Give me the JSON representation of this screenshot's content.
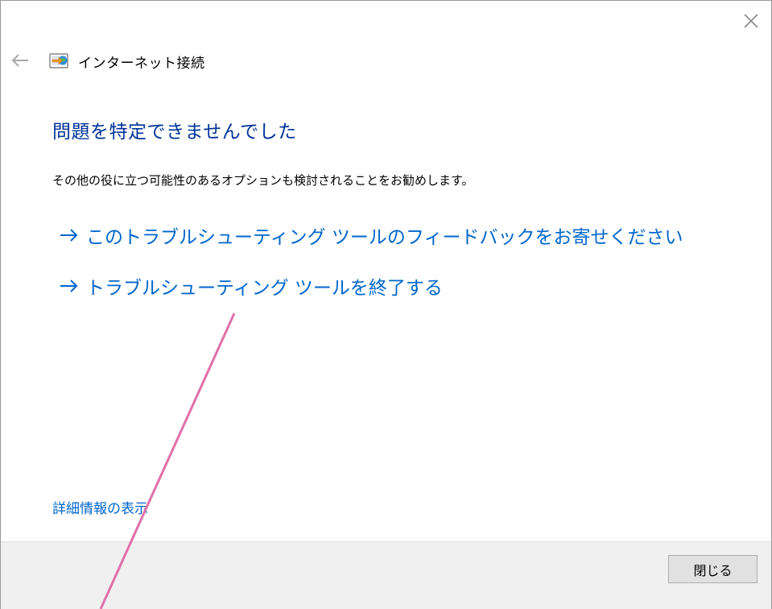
{
  "window": {
    "title": "インターネット接続",
    "close_icon": "close-icon",
    "back_icon": "back-arrow-icon",
    "app_icon": "network-connection-icon"
  },
  "main": {
    "heading": "問題を特定できませんでした",
    "description": "その他の役に立つ可能性のあるオプションも検討されることをお勧めします。",
    "options": [
      {
        "label": "このトラブルシューティング ツールのフィードバックをお寄せください",
        "icon": "arrow-right-icon"
      },
      {
        "label": "トラブルシューティング ツールを終了する",
        "icon": "arrow-right-icon"
      }
    ],
    "details_link": "詳細情報の表示"
  },
  "footer": {
    "close_button": "閉じる"
  },
  "colors": {
    "heading": "#003399",
    "link": "#0066cc",
    "annotation_line": "#e070a8",
    "footer_bg": "#f0f0f0"
  }
}
